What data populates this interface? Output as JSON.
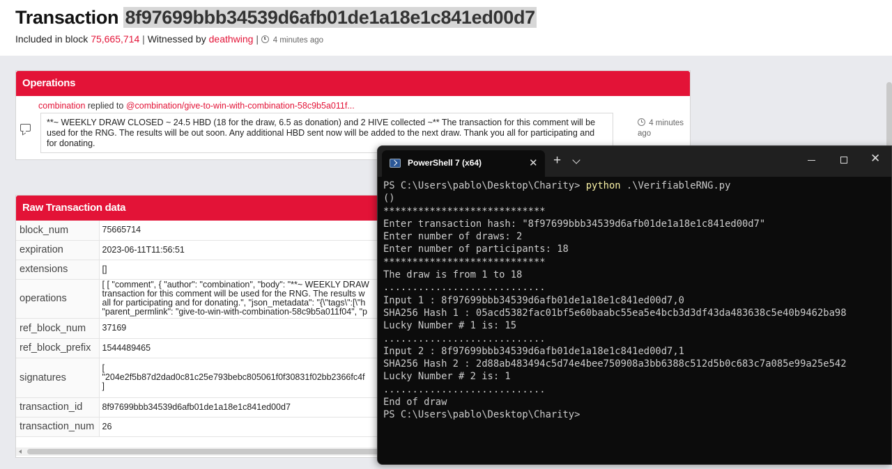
{
  "header": {
    "title_prefix": "Transaction",
    "tx_hash": "8f97699bbb34539d6afb01de1a18e1c841ed00d7",
    "included_label": "Included in block",
    "block_number": "75,665,714",
    "witnessed_label": "Witnessed by",
    "witness": "deathwing",
    "time_ago": "4 minutes ago"
  },
  "operations": {
    "title": "Operations",
    "author": "combination",
    "action": "replied to",
    "target": "@combination/give-to-win-with-combination-58c9b5a011f...",
    "body": "**~ WEEKLY DRAW CLOSED ~ 24.5 HBD (18 for the draw, 6.5 as donation) and 2 HIVE collected ~** The transaction for this comment will be used for the RNG. The results will be out soon. Any additional HBD sent now will be added to the next draw. Thank you all for participating and for donating.",
    "time_ago": "4 minutes ago"
  },
  "raw": {
    "title": "Raw Transaction data",
    "rows": [
      {
        "key": "block_num",
        "lines": [
          "75665714"
        ]
      },
      {
        "key": "expiration",
        "lines": [
          "2023-06-11T11:56:51"
        ]
      },
      {
        "key": "extensions",
        "lines": [
          "[]"
        ]
      },
      {
        "key": "operations",
        "lines": [
          "[ [ \"comment\", { \"author\": \"combination\", \"body\": \"**~ WEEKLY DRAW",
          "transaction for this comment will be used for the RNG. The results w",
          "all for participating and for donating.\", \"json_metadata\": \"{\\\"tags\\\":[\\\"h",
          "\"parent_permlink\": \"give-to-win-with-combination-58c9b5a011f04\", \"p"
        ]
      },
      {
        "key": "ref_block_num",
        "lines": [
          "37169"
        ]
      },
      {
        "key": "ref_block_prefix",
        "lines": [
          "1544489465"
        ]
      },
      {
        "key": "signatures",
        "lines": [
          "[",
          "\"204e2f5b87d2dad0c81c25e793bebc805061f0f30831f02bb2366fc4f",
          "]"
        ]
      },
      {
        "key": "transaction_id",
        "lines": [
          "8f97699bbb34539d6afb01de1a18e1c841ed00d7"
        ]
      },
      {
        "key": "transaction_num",
        "lines": [
          "26"
        ]
      }
    ]
  },
  "terminal": {
    "tab_title": "PowerShell 7 (x64)",
    "prompt": "PS C:\\Users\\pablo\\Desktop\\Charity>",
    "command": "python",
    "command_arg": ".\\VerifiableRNG.py",
    "output": [
      "()",
      "****************************",
      "Enter transaction hash: \"8f97699bbb34539d6afb01de1a18e1c841ed00d7\"",
      "Enter number of draws: 2",
      "Enter number of participants: 18",
      "****************************",
      "The draw is from 1 to 18",
      "............................",
      "Input 1 : 8f97699bbb34539d6afb01de1a18e1c841ed00d7,0",
      "SHA256 Hash 1 : 05acd5382fac01bf5e60baabc55ea5e4bcb3d3df43da483638c5e40b9462ba98",
      "Lucky Number # 1 is: 15",
      "............................",
      "Input 2 : 8f97699bbb34539d6afb01de1a18e1c841ed00d7,1",
      "SHA256 Hash 2 : 2d88ab483494c5d74e4bee750908a3bb6388c512d5b0c683c7a085e99a25e542",
      "Lucky Number # 2 is: 1",
      "............................",
      "End of draw"
    ],
    "final_prompt": "PS C:\\Users\\pablo\\Desktop\\Charity>"
  },
  "colors": {
    "accent": "#e31337",
    "terminal_bg": "#0c0c0c",
    "command_yellow": "#f9f1a5"
  }
}
